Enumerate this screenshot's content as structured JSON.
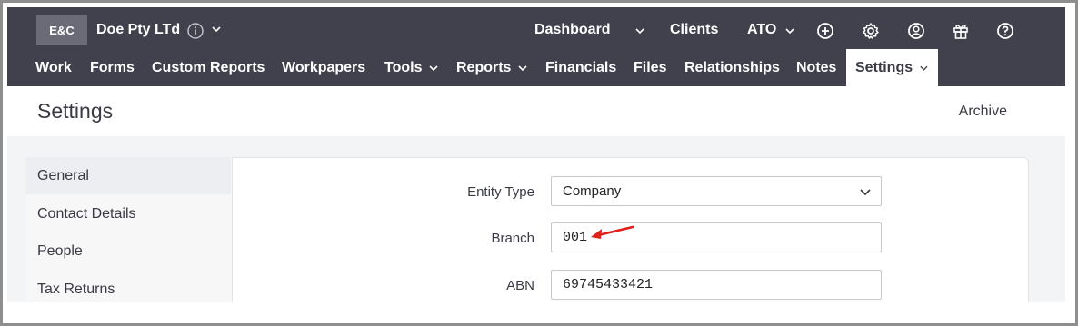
{
  "topbar": {
    "logo": "E&C",
    "entity_name": "Doe Pty LTd",
    "dashboard": "Dashboard",
    "clients": "Clients",
    "ato": "ATO"
  },
  "nav": {
    "items": [
      "Work",
      "Forms",
      "Custom Reports",
      "Workpapers",
      "Tools",
      "Reports",
      "Financials",
      "Files",
      "Relationships",
      "Notes",
      "Settings"
    ]
  },
  "page": {
    "title": "Settings",
    "archive": "Archive"
  },
  "side_menu": {
    "items": [
      "General",
      "Contact Details",
      "People",
      "Tax Returns"
    ],
    "active": "General"
  },
  "form": {
    "entity_type_label": "Entity Type",
    "entity_type_value": "Company",
    "branch_label": "Branch",
    "branch_value": "001",
    "abn_label": "ABN",
    "abn_value": "69745433421"
  },
  "colors": {
    "topbar": "#41414d",
    "annotation_arrow": "#e0201b"
  },
  "icons": [
    "info-icon",
    "chevron-down-icon",
    "plus-circle-icon",
    "gear-icon",
    "user-circle-icon",
    "gift-icon",
    "help-circle-icon"
  ]
}
